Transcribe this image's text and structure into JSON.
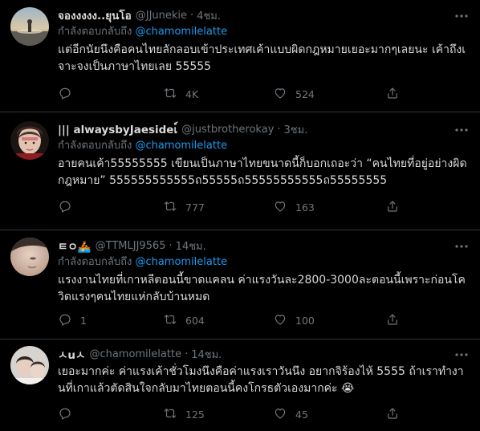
{
  "tweets": [
    {
      "display_name": "จองงงงง..ยุนโอ",
      "handle": "@JJunekie",
      "sep": "·",
      "time": "4ชม.",
      "reply_prefix": "กำลังตอบกลับถึง",
      "reply_to": "@chamomilelatte",
      "text": "แต่อีกนัยนึงคือคนไทยลักลอบเข้าประเทศเค้าแบบผิดกฎหมายเยอะมากๆเลยนะ เค้าถึงเจาะจงเป็นภาษาไทยเลย 55555",
      "reply_count": "",
      "retweet_count": "4K",
      "like_count": "524"
    },
    {
      "display_name": "||| alwaysbyJaesideเ์",
      "handle": "@justbrotherokay",
      "sep": "·",
      "time": "3ชม.",
      "reply_prefix": "กำลังตอบกลับถึง",
      "reply_to": "@chamomilelatte",
      "text": "อายคนเค้า55555555 เขียนเป็นภาษาไทยขนาดนี้ก็บอกเถอะว่า “คนไทยที่อยู่อย่างผิดกฎหมาย” 555555555555ถ55555ถ55555555555ถ55555555",
      "reply_count": "",
      "retweet_count": "777",
      "like_count": "163"
    },
    {
      "display_name": "ㅌㅇ🚣",
      "handle": "@TTMLJJ9565",
      "sep": "·",
      "time": "14ชม.",
      "reply_prefix": "กำลังตอบกลับถึง",
      "reply_to": "@chamomilelatte",
      "text": "แรงงานไทยที่เกาหลีตอนนี้ขาดแคลน ค่าแรงวันละ2800-3000ละตอนนี้เพราะก่อนโควิดแรงๆคนไทยแห่กลับบ้านหมด",
      "reply_count": "1",
      "retweet_count": "604",
      "like_count": "100"
    },
    {
      "display_name": "ㅅuㅅ",
      "handle": "@chamomilelatte",
      "sep": "·",
      "time": "14ชม.",
      "text": "เยอะมากค่ะ ค่าแรงเค้าชั่วโมงนึงคือค่าแรงเราวันนึง อยากจิร้องไห้ 5555 ถ้าเราทำงานที่เกาแล้วตัดสินใจกลับมาไทยตอนนี้คงโกรธตัวเองมากค่ะ 😭",
      "reply_count": "",
      "retweet_count": "125",
      "like_count": "45"
    }
  ],
  "colors": {
    "background": "#000000",
    "text": "#d9d9d9",
    "muted": "#6e767d",
    "accent": "#1d9bf0",
    "divider": "#2f3336"
  }
}
